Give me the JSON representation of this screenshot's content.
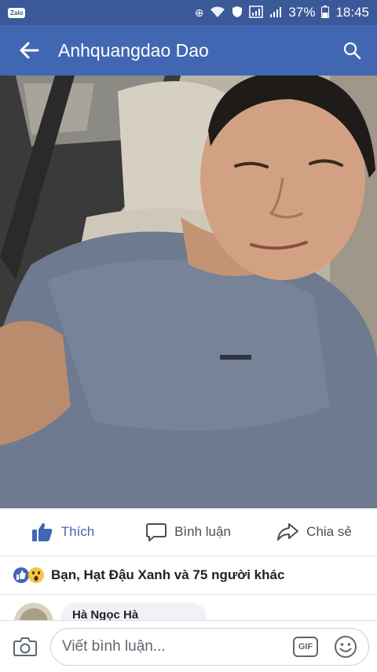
{
  "status_bar": {
    "app_badge": "Zalo",
    "battery": "37%",
    "time": "18:45"
  },
  "header": {
    "title": "Anhquangdao Dao"
  },
  "actions": {
    "like": "Thích",
    "comment": "Bình luận",
    "share": "Chia sẻ"
  },
  "reactions": {
    "summary": "Bạn, Hạt Đậu Xanh và 75 người khác"
  },
  "comment_preview": {
    "name": "Hà Ngọc Hà"
  },
  "composer": {
    "placeholder": "Viết bình luận...",
    "gif_label": "GIF"
  },
  "colors": {
    "status_bar": "#3b5998",
    "app_bar": "#4267b2",
    "like_blue": "#4267b2"
  }
}
